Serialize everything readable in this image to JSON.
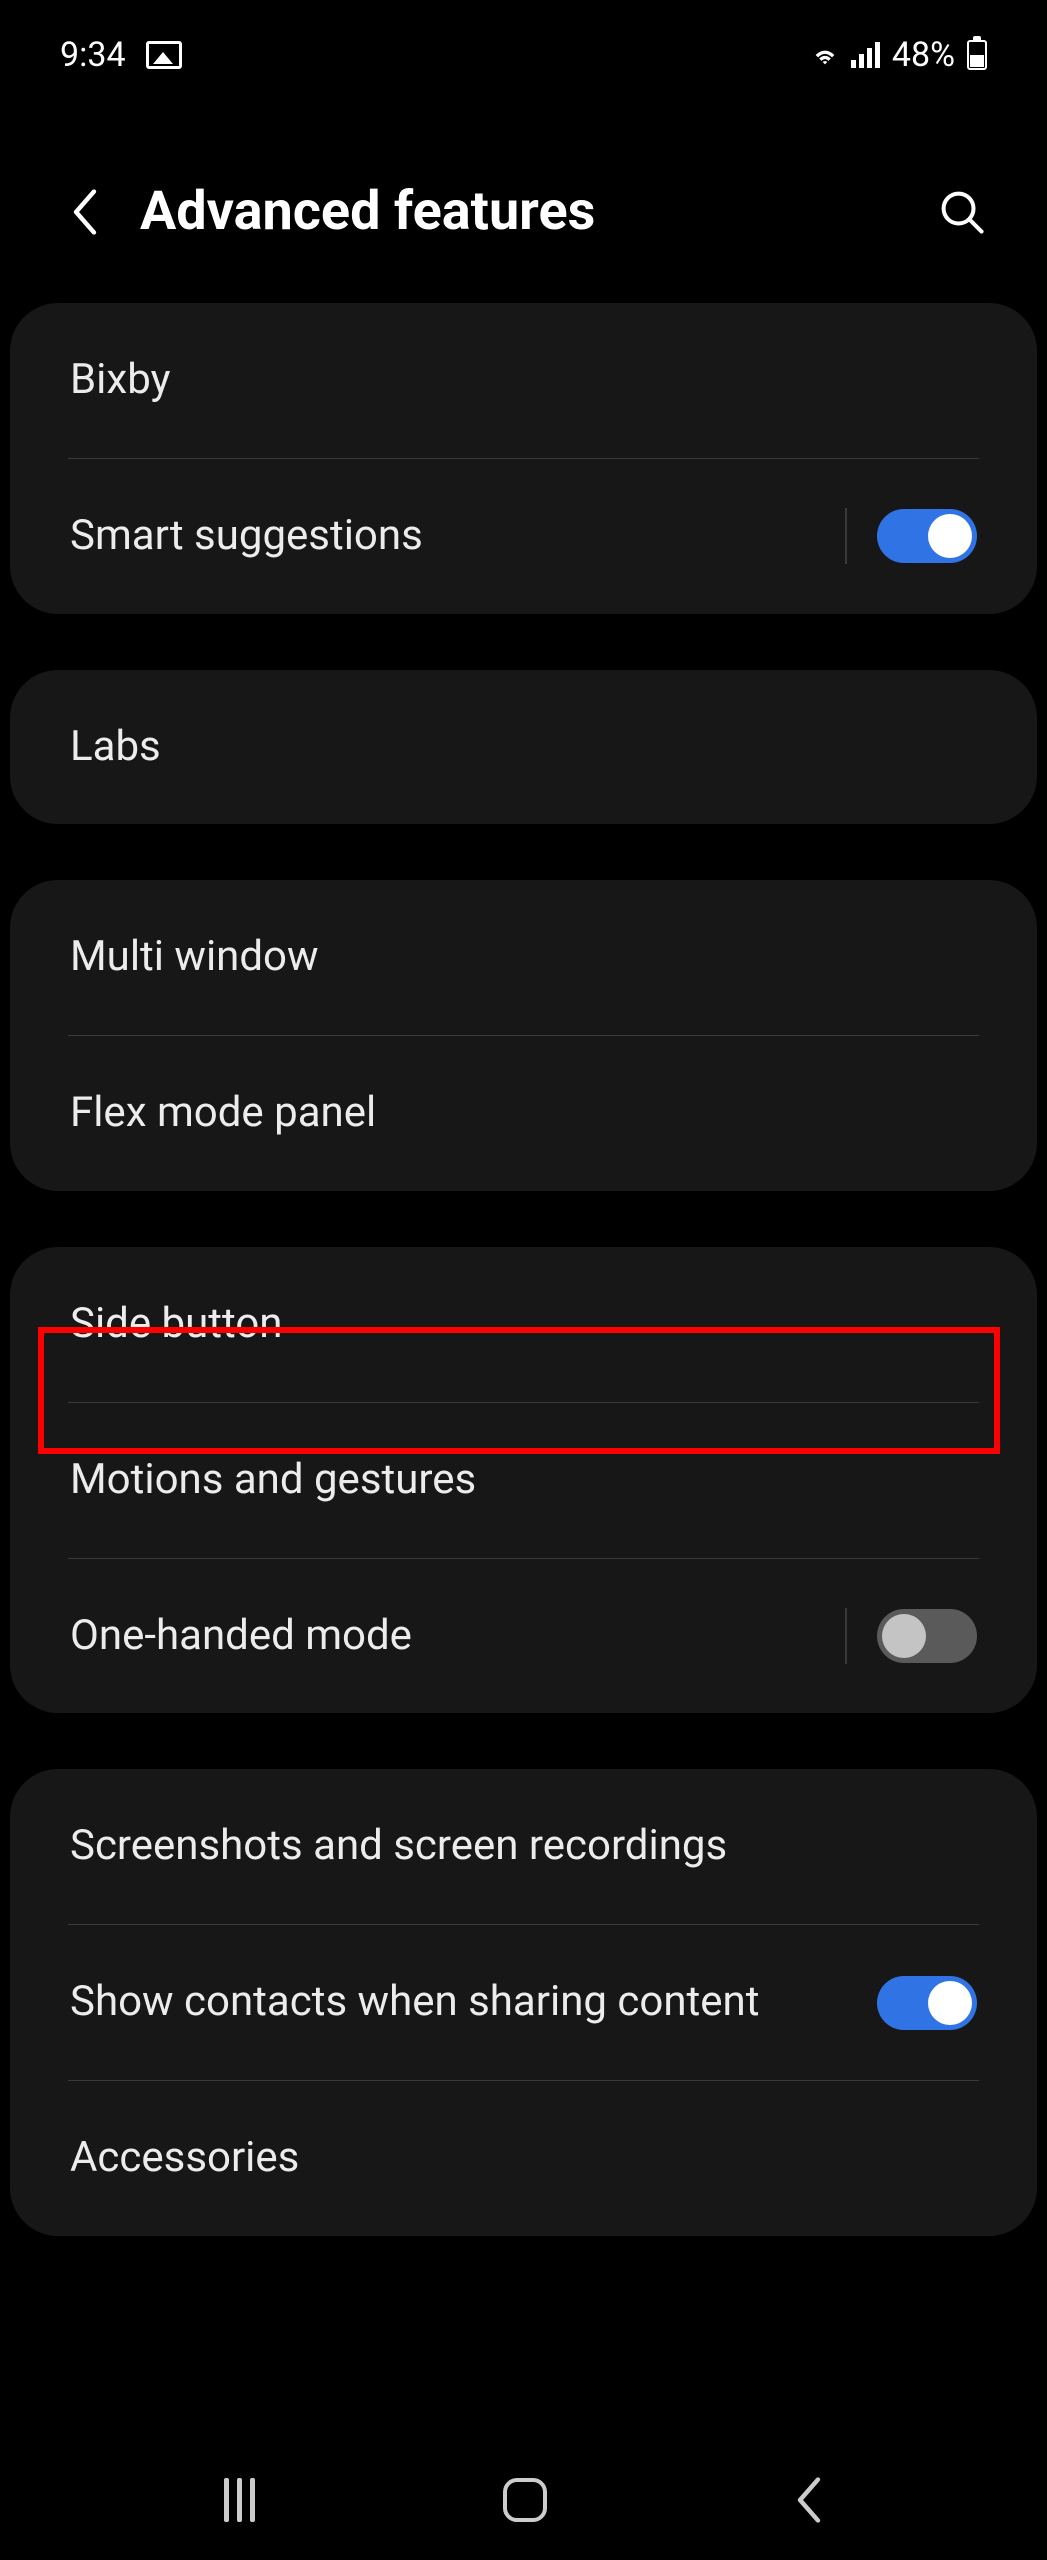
{
  "status": {
    "time": "9:34",
    "battery_pct": "48%"
  },
  "header": {
    "title": "Advanced features"
  },
  "groups": [
    {
      "items": [
        {
          "label": "Bixby",
          "toggle": null,
          "highlight": false,
          "vdiv": false
        },
        {
          "label": "Smart suggestions",
          "toggle": true,
          "highlight": false,
          "vdiv": true
        }
      ]
    },
    {
      "items": [
        {
          "label": "Labs",
          "toggle": null,
          "highlight": false,
          "vdiv": false
        }
      ]
    },
    {
      "items": [
        {
          "label": "Multi window",
          "toggle": null,
          "highlight": false,
          "vdiv": false
        },
        {
          "label": "Flex mode panel",
          "toggle": null,
          "highlight": false,
          "vdiv": false
        }
      ]
    },
    {
      "items": [
        {
          "label": "Side button",
          "toggle": null,
          "highlight": true,
          "vdiv": false
        },
        {
          "label": "Motions and gestures",
          "toggle": null,
          "highlight": false,
          "vdiv": false
        },
        {
          "label": "One-handed mode",
          "toggle": false,
          "highlight": false,
          "vdiv": true
        }
      ]
    },
    {
      "items": [
        {
          "label": "Screenshots and screen recordings",
          "toggle": null,
          "highlight": false,
          "vdiv": false
        },
        {
          "label": "Show contacts when sharing content",
          "toggle": true,
          "highlight": false,
          "vdiv": false
        },
        {
          "label": "Accessories",
          "toggle": null,
          "highlight": false,
          "vdiv": false
        }
      ]
    }
  ]
}
